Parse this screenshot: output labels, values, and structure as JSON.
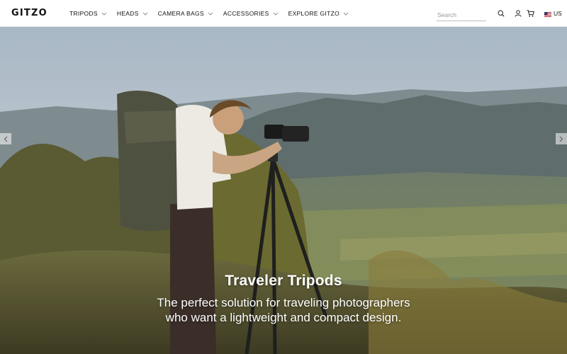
{
  "brand": {
    "logo_text": "GITZO"
  },
  "nav": {
    "items": [
      {
        "label": "TRIPODS"
      },
      {
        "label": "HEADS"
      },
      {
        "label": "CAMERA BAGS"
      },
      {
        "label": "ACCESSORIES"
      },
      {
        "label": "EXPLORE GITZO"
      }
    ]
  },
  "search": {
    "placeholder": "Search",
    "value": ""
  },
  "header_icons": [
    "search-icon",
    "user-icon",
    "cart-icon"
  ],
  "locale": {
    "label": "US",
    "flag": "us-flag-icon"
  },
  "hero": {
    "title": "Traveler Tripods",
    "subtitle_line1": "The perfect solution for traveling photographers",
    "subtitle_line2": "who want a lightweight and compact design."
  },
  "carousel": {
    "prev_icon": "chevron-left-icon",
    "next_icon": "chevron-right-icon"
  },
  "colors": {
    "header_bg": "#ffffff",
    "text": "#111111",
    "hero_text": "#ffffff"
  }
}
